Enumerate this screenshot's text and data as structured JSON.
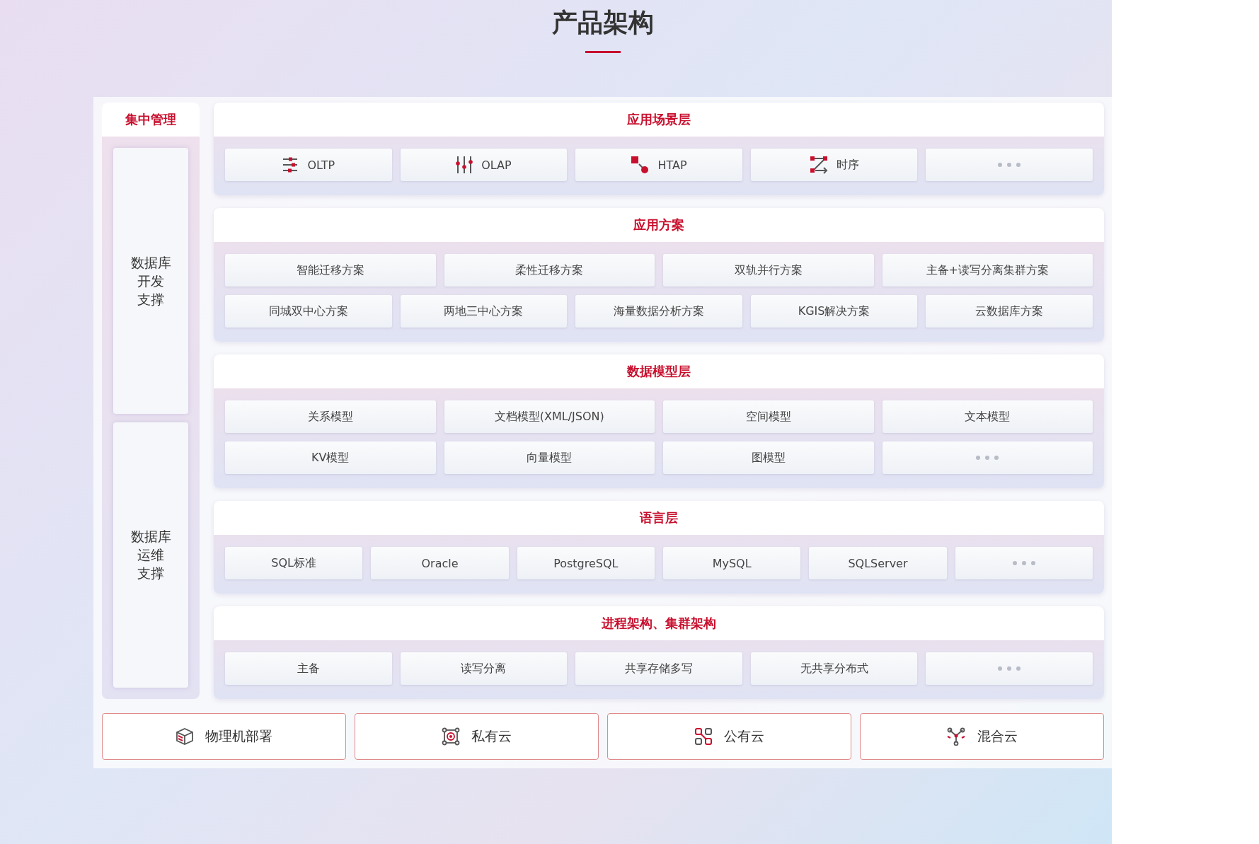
{
  "title": "产品架构",
  "side": {
    "title": "集中管理",
    "blocks": [
      {
        "lines": [
          "数据库",
          "开发",
          "支撑"
        ]
      },
      {
        "lines": [
          "数据库",
          "运维",
          "支撑"
        ]
      }
    ]
  },
  "layers": [
    {
      "title": "应用场景层",
      "bands": [
        {
          "items": [
            {
              "label": "OLTP",
              "kind": "sliders"
            },
            {
              "label": "OLAP",
              "kind": "equalizer"
            },
            {
              "label": "HTAP",
              "kind": "htap"
            },
            {
              "label": "时序",
              "kind": "flow"
            },
            {
              "kind": "more"
            }
          ]
        }
      ]
    },
    {
      "title": "应用方案",
      "bands": [
        {
          "items": [
            {
              "label": "智能迁移方案"
            },
            {
              "label": "柔性迁移方案"
            },
            {
              "label": "双轨并行方案"
            },
            {
              "label": "主备+读写分离集群方案"
            }
          ]
        },
        {
          "items": [
            {
              "label": "同城双中心方案"
            },
            {
              "label": "两地三中心方案"
            },
            {
              "label": "海量数据分析方案"
            },
            {
              "label": "KGIS解决方案"
            },
            {
              "label": "云数据库方案"
            }
          ]
        }
      ]
    },
    {
      "title": "数据模型层",
      "bands": [
        {
          "items": [
            {
              "label": "关系模型"
            },
            {
              "label": "文档模型(XML/JSON)"
            },
            {
              "label": "空间模型"
            },
            {
              "label": "文本模型"
            }
          ]
        },
        {
          "items": [
            {
              "label": "KV模型"
            },
            {
              "label": "向量模型"
            },
            {
              "label": "图模型"
            },
            {
              "kind": "more"
            }
          ]
        }
      ]
    },
    {
      "title": "语言层",
      "bands": [
        {
          "items": [
            {
              "label": "SQL标准"
            },
            {
              "label": "Oracle"
            },
            {
              "label": "PostgreSQL"
            },
            {
              "label": "MySQL"
            },
            {
              "label": "SQLServer"
            },
            {
              "kind": "more"
            }
          ]
        }
      ]
    },
    {
      "title": "进程架构、集群架构",
      "bands": [
        {
          "items": [
            {
              "label": "主备"
            },
            {
              "label": "读写分离"
            },
            {
              "label": "共享存储多写"
            },
            {
              "label": "无共享分布式"
            },
            {
              "kind": "more"
            }
          ]
        }
      ]
    }
  ],
  "deploy": [
    {
      "label": "物理机部署",
      "kind": "cube"
    },
    {
      "label": "私有云",
      "kind": "frame"
    },
    {
      "label": "公有云",
      "kind": "nodes"
    },
    {
      "label": "混合云",
      "kind": "hub"
    }
  ]
}
